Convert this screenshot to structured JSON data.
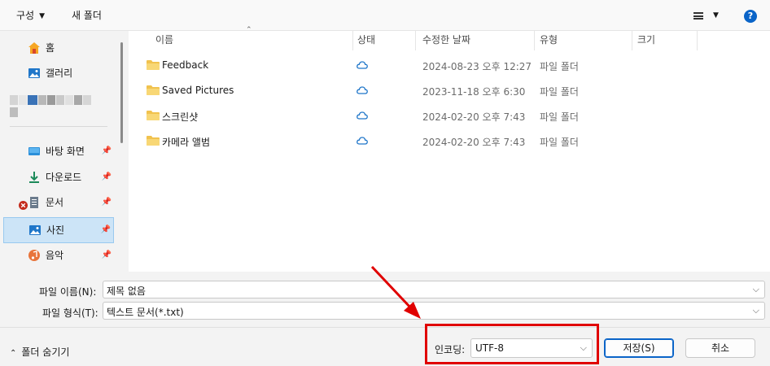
{
  "toolbar": {
    "organize_label": "구성",
    "new_folder_label": "새 폴더",
    "help_label": "?"
  },
  "sidebar": {
    "items": [
      {
        "label": "홈",
        "icon": "home-icon"
      },
      {
        "label": "갤러리",
        "icon": "gallery-icon"
      },
      {
        "label": "바탕 화면",
        "icon": "desktop-icon",
        "pinned": true
      },
      {
        "label": "다운로드",
        "icon": "download-icon",
        "pinned": true
      },
      {
        "label": "문서",
        "icon": "document-icon",
        "pinned": true
      },
      {
        "label": "사진",
        "icon": "pictures-icon",
        "pinned": true,
        "selected": true
      },
      {
        "label": "음악",
        "icon": "music-icon",
        "pinned": true
      }
    ]
  },
  "columns": {
    "name": "이름",
    "status": "상태",
    "modified": "수정한 날짜",
    "type": "유형",
    "size": "크기"
  },
  "files": [
    {
      "name": "Feedback",
      "modified": "2024-08-23 오후 12:27",
      "type": "파일 폴더"
    },
    {
      "name": "Saved Pictures",
      "modified": "2023-11-18 오후 6:30",
      "type": "파일 폴더"
    },
    {
      "name": "스크린샷",
      "modified": "2024-02-20 오후 7:43",
      "type": "파일 폴더"
    },
    {
      "name": "카메라 앨범",
      "modified": "2024-02-20 오후 7:43",
      "type": "파일 폴더"
    }
  ],
  "form": {
    "filename_label": "파일 이름(N):",
    "filename_value": "제목 없음",
    "filetype_label": "파일 형식(T):",
    "filetype_value": "텍스트 문서(*.txt)",
    "encoding_label": "인코딩:",
    "encoding_value": "UTF-8"
  },
  "footer": {
    "hide_folders_label": "폴더 숨기기",
    "save_label": "저장(S)",
    "cancel_label": "취소"
  },
  "colors": {
    "accent": "#0a64c8",
    "highlight_box": "#e00000",
    "selected_bg": "#cce4f7"
  }
}
